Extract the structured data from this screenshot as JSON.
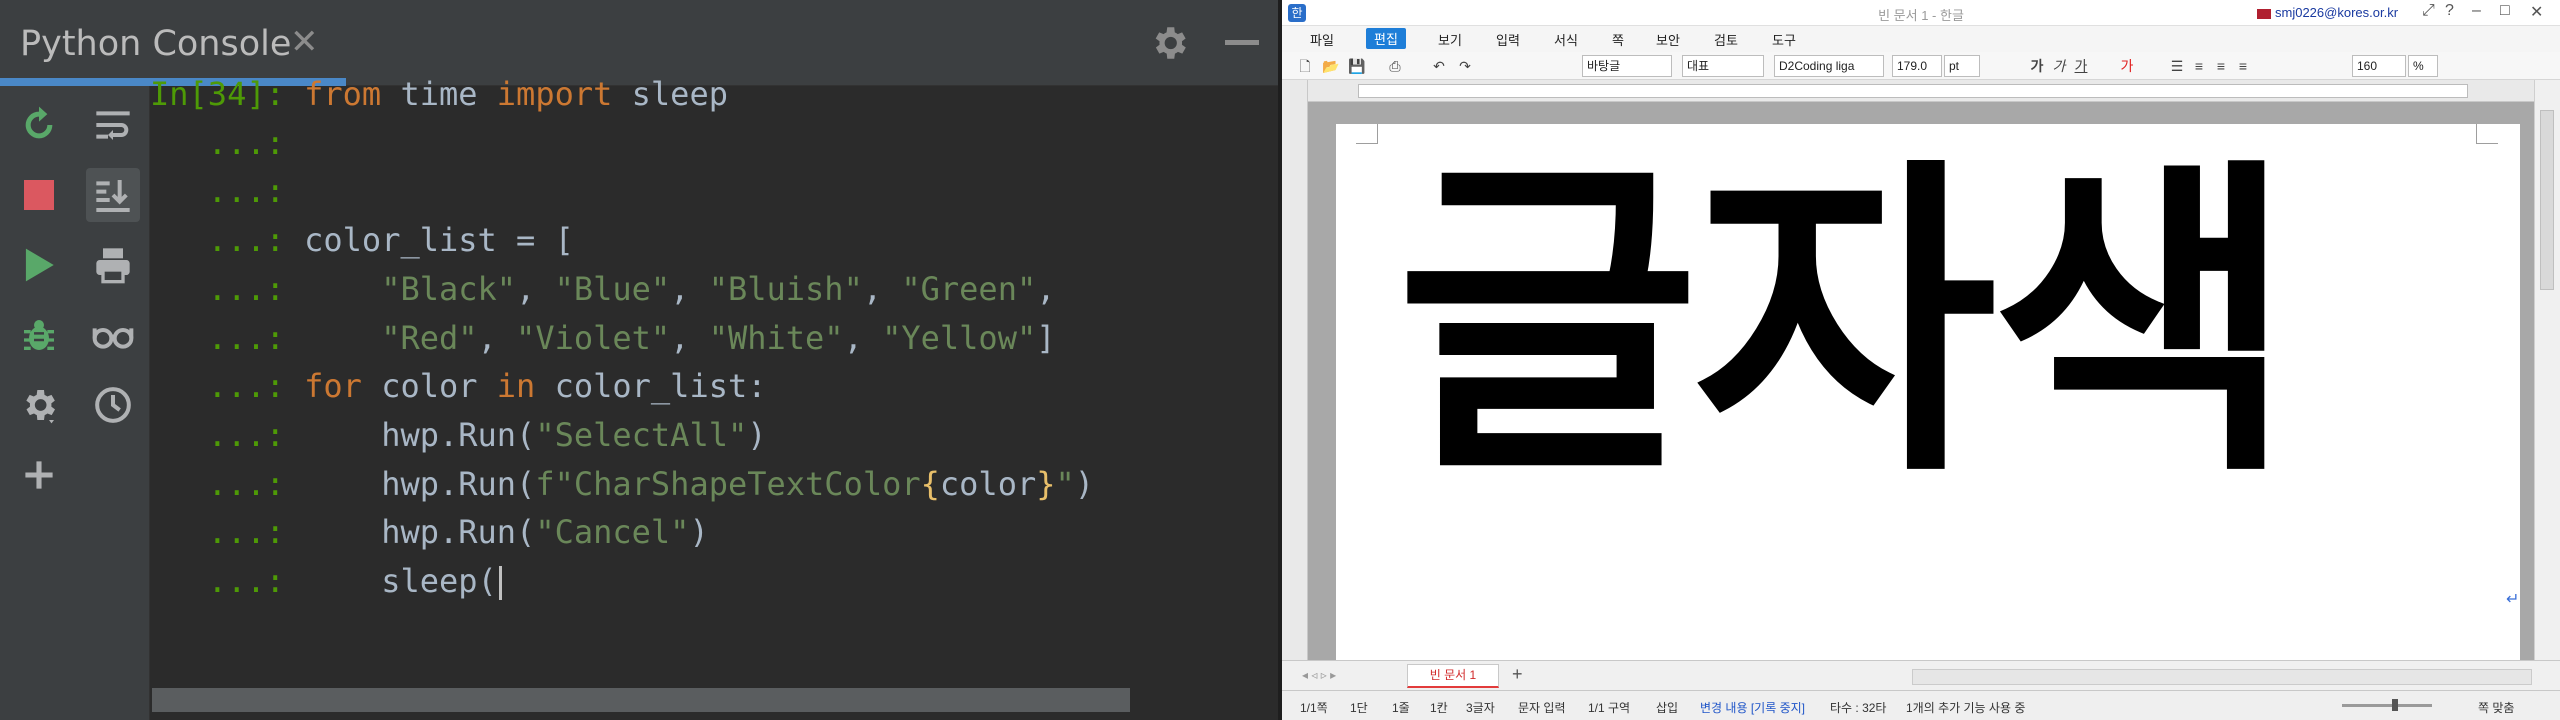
{
  "console": {
    "tab_title": "Python Console",
    "close_glyph": "✕",
    "lines": [
      {
        "prompt": "In[34]:",
        "parts": [
          {
            "t": "kw",
            "v": "from"
          },
          {
            "t": "plain",
            "v": " time "
          },
          {
            "t": "kw",
            "v": "import"
          },
          {
            "t": "plain",
            "v": " sleep"
          }
        ]
      },
      {
        "prompt": "   ...:",
        "parts": []
      },
      {
        "prompt": "   ...:",
        "parts": []
      },
      {
        "prompt": "   ...:",
        "parts": [
          {
            "t": "plain",
            "v": "color_list = ["
          }
        ]
      },
      {
        "prompt": "   ...:",
        "parts": [
          {
            "t": "plain",
            "v": "    "
          },
          {
            "t": "str",
            "v": "\"Black\""
          },
          {
            "t": "plain",
            "v": ", "
          },
          {
            "t": "str",
            "v": "\"Blue\""
          },
          {
            "t": "plain",
            "v": ", "
          },
          {
            "t": "str",
            "v": "\"Bluish\""
          },
          {
            "t": "plain",
            "v": ", "
          },
          {
            "t": "str",
            "v": "\"Green\""
          },
          {
            "t": "plain",
            "v": ","
          }
        ]
      },
      {
        "prompt": "   ...:",
        "parts": [
          {
            "t": "plain",
            "v": "    "
          },
          {
            "t": "str",
            "v": "\"Red\""
          },
          {
            "t": "plain",
            "v": ", "
          },
          {
            "t": "str",
            "v": "\"Violet\""
          },
          {
            "t": "plain",
            "v": ", "
          },
          {
            "t": "str",
            "v": "\"White\""
          },
          {
            "t": "plain",
            "v": ", "
          },
          {
            "t": "str",
            "v": "\"Yellow\""
          },
          {
            "t": "plain",
            "v": "]"
          }
        ]
      },
      {
        "prompt": "   ...:",
        "parts": [
          {
            "t": "kw",
            "v": "for"
          },
          {
            "t": "plain",
            "v": " color "
          },
          {
            "t": "kw",
            "v": "in"
          },
          {
            "t": "plain",
            "v": " color_list:"
          }
        ]
      },
      {
        "prompt": "   ...:",
        "parts": [
          {
            "t": "plain",
            "v": "    hwp.Run("
          },
          {
            "t": "str",
            "v": "\"SelectAll\""
          },
          {
            "t": "plain",
            "v": ")"
          }
        ]
      },
      {
        "prompt": "   ...:",
        "parts": [
          {
            "t": "plain",
            "v": "    hwp.Run("
          },
          {
            "t": "str",
            "v": "f\"CharShapeTextColor"
          },
          {
            "t": "hbr",
            "v": "{"
          },
          {
            "t": "plain",
            "v": "color"
          },
          {
            "t": "hbr",
            "v": "}"
          },
          {
            "t": "str",
            "v": "\""
          },
          {
            "t": "plain",
            "v": ")"
          }
        ]
      },
      {
        "prompt": "   ...:",
        "parts": [
          {
            "t": "plain",
            "v": "    hwp.Run("
          },
          {
            "t": "str",
            "v": "\"Cancel\""
          },
          {
            "t": "plain",
            "v": ")"
          }
        ]
      },
      {
        "prompt": "   ...:",
        "parts": [
          {
            "t": "plain",
            "v": "    sleep("
          }
        ],
        "caret": true
      }
    ],
    "toolbar_left_icons": [
      "rerun-icon",
      "stop-icon",
      "run-icon",
      "debug-icon",
      "settings-icon",
      "add-icon"
    ],
    "toolbar_right_icons": [
      "soft-wrap-icon",
      "scroll-to-end-icon",
      "print-icon",
      "show-variables-icon",
      "history-icon"
    ],
    "colors": {
      "keyword": "#cc7832",
      "string": "#6a8759",
      "plain": "#a9b7c6",
      "prompt": "#4e9a06",
      "accent": "#4a88c7"
    }
  },
  "hwp": {
    "window_title": "빈 문서 1 - 한글",
    "user": "smj0226@kores.or.kr",
    "menus": [
      "파일",
      "편집",
      "보기",
      "입력",
      "서식",
      "쪽",
      "보안",
      "검토",
      "도구"
    ],
    "active_menu": "편집",
    "toolbar": {
      "style": "바탕글",
      "lang": "대표",
      "font": "D2Coding liga",
      "size": "179.0",
      "unit": "pt",
      "zoom": "160",
      "zoom_unit": "%",
      "char_buttons": [
        "가",
        "가",
        "가"
      ]
    },
    "document_text": "글자색",
    "tab_label": "빈 문서 1",
    "add_tab": "+",
    "status": {
      "page": "1/1쪽",
      "section": "1단",
      "line": "1줄",
      "column": "1칸",
      "chars": "3글자",
      "input": "문자 입력",
      "region": "1/1 구역",
      "insert": "삽입",
      "track": "변경 내용 [기록 중지]",
      "typos": "타수 : 32타",
      "info": "1개의 추가 기능 사용 중",
      "fit": "쪽 맞춤"
    }
  }
}
